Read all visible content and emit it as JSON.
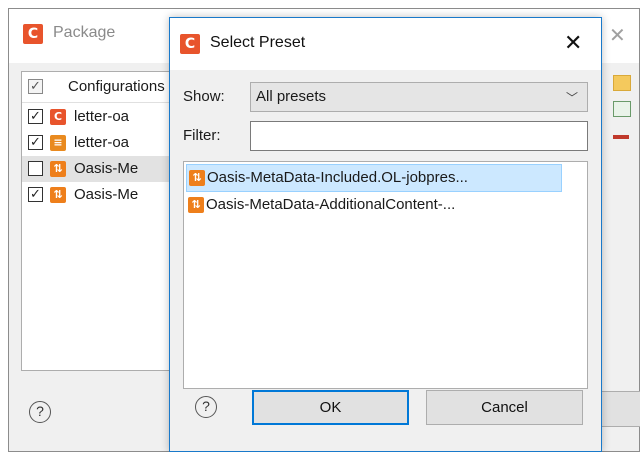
{
  "package_window": {
    "title": "Package",
    "close_glyph": "✕",
    "list_header": "Configurations",
    "rows": [
      {
        "checked": true,
        "icon": "c-icon",
        "label": "letter-oa"
      },
      {
        "checked": true,
        "icon": "database-icon",
        "label": "letter-oa"
      },
      {
        "checked": false,
        "icon": "settings-icon",
        "label": "Oasis-Me",
        "selected": true
      },
      {
        "checked": true,
        "icon": "settings-icon",
        "label": "Oasis-Me"
      }
    ],
    "help_glyph": "?"
  },
  "dialog": {
    "title": "Select Preset",
    "app_icon_letter": "C",
    "close_glyph": "✕",
    "show_label": "Show:",
    "show_value": "All presets",
    "filter_label": "Filter:",
    "filter_value": "",
    "presets": [
      {
        "label": "Oasis-MetaData-Included.OL-jobpres...",
        "selected": true
      },
      {
        "label": "Oasis-MetaData-AdditionalContent-...",
        "selected": false
      }
    ],
    "help_glyph": "?",
    "ok_label": "OK",
    "cancel_label": "Cancel"
  },
  "colors": {
    "accent": "#0078d7",
    "app_icon": "#e8542c",
    "preset_icon": "#ee7f1b",
    "selection": "#cce8ff"
  }
}
